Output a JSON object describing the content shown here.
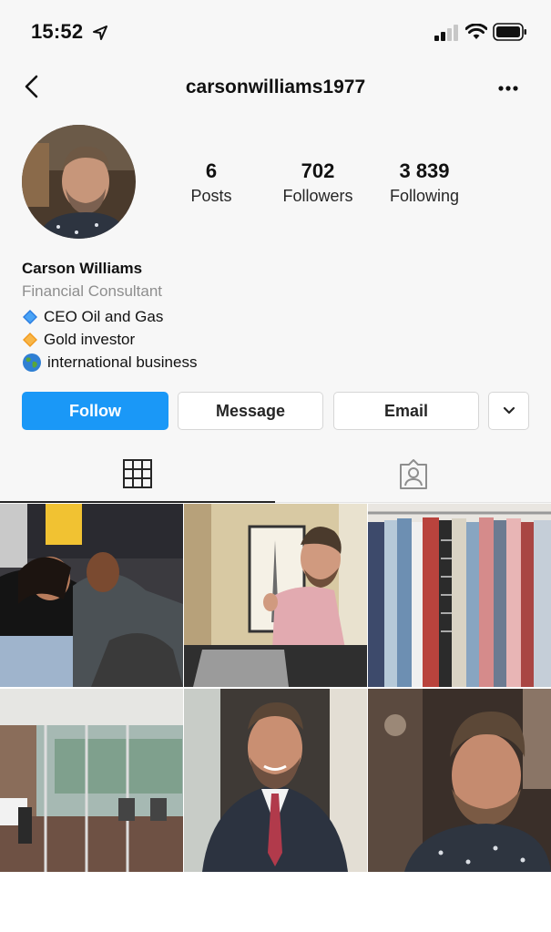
{
  "status_bar": {
    "time": "15:52"
  },
  "header": {
    "username": "carsonwilliams1977"
  },
  "stats": [
    {
      "value": "6",
      "label": "Posts"
    },
    {
      "value": "702",
      "label": "Followers"
    },
    {
      "value": "3 839",
      "label": "Following"
    }
  ],
  "bio": {
    "name": "Carson Williams",
    "category": "Financial Consultant",
    "lines": [
      {
        "icon": "blue-diamond-icon",
        "text": "CEO Oil and Gas"
      },
      {
        "icon": "orange-diamond-icon",
        "text": "Gold investor"
      },
      {
        "icon": "globe-icon",
        "text": "international business"
      }
    ]
  },
  "actions": {
    "follow": "Follow",
    "message": "Message",
    "email": "Email"
  },
  "colors": {
    "follow_blue": "#1a98f7",
    "background": "#f7f7f7",
    "category_gray": "#8e8e8e"
  }
}
